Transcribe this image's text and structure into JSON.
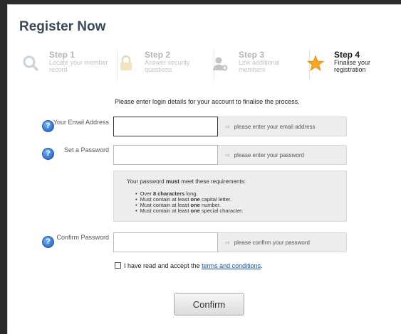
{
  "title": "Register Now",
  "steps": [
    {
      "label": "Step 1",
      "desc": "Locate your member record",
      "icon": "magnifier-icon",
      "active": false
    },
    {
      "label": "Step 2",
      "desc": "Answer security questions",
      "icon": "lock-icon",
      "active": false
    },
    {
      "label": "Step 3",
      "desc": "Link additional members",
      "icon": "user-add-icon",
      "active": false
    },
    {
      "label": "Step 4",
      "desc": "Finalise your registration",
      "icon": "star-icon",
      "active": true
    }
  ],
  "intro": "Please enter login details for your account to finalise the process.",
  "fields": {
    "email": {
      "label": "Your Email Address",
      "hint": "please enter your email address",
      "value": ""
    },
    "password": {
      "label": "Set a Password",
      "hint": "please enter your password",
      "value": ""
    },
    "confirm": {
      "label": "Confirm Password",
      "hint": "please confirm your password",
      "value": ""
    }
  },
  "requirements": {
    "title_pre": "Your password ",
    "title_bold": "must",
    "title_post": " meet these requirements:",
    "items": [
      {
        "pre": "Over ",
        "bold": "8 characters",
        "post": " long."
      },
      {
        "pre": "Must contain at least ",
        "bold": "one",
        "post": " capital letter."
      },
      {
        "pre": "Must contain at least ",
        "bold": "one",
        "post": " number."
      },
      {
        "pre": "Must contain at least ",
        "bold": "one",
        "post": " special character."
      }
    ]
  },
  "terms": {
    "pre": "I have read and accept the ",
    "link": "terms and conditions",
    "post": "."
  },
  "confirm_label": "Confirm",
  "help_glyph": "?",
  "arrow_glyph": "⇨",
  "colors": {
    "accent_link": "#1a4fa0",
    "star": "#f5a623",
    "help": "#2d6fd0"
  }
}
